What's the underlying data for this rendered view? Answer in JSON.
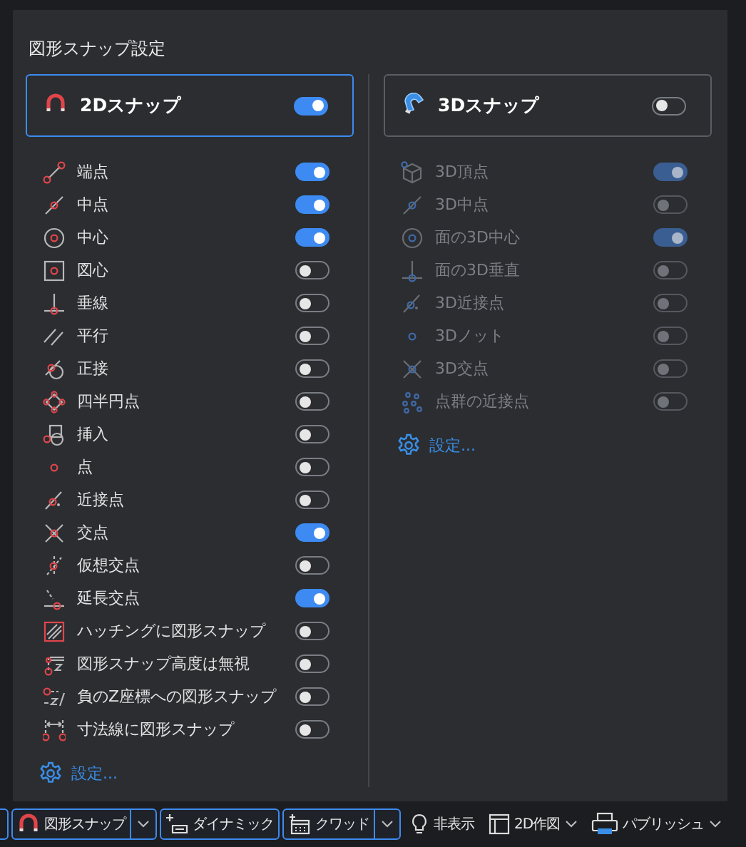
{
  "panel": {
    "title": "図形スナップ設定",
    "sections": [
      {
        "title": "2Dスナップ",
        "selected": true,
        "on": true,
        "disabled": false,
        "settings_link": "設定...",
        "items": [
          {
            "label": "端点",
            "on": true
          },
          {
            "label": "中点",
            "on": true
          },
          {
            "label": "中心",
            "on": true
          },
          {
            "label": "図心",
            "on": false
          },
          {
            "label": "垂線",
            "on": false
          },
          {
            "label": "平行",
            "on": false
          },
          {
            "label": "正接",
            "on": false
          },
          {
            "label": "四半円点",
            "on": false
          },
          {
            "label": "挿入",
            "on": false
          },
          {
            "label": "点",
            "on": false
          },
          {
            "label": "近接点",
            "on": false
          },
          {
            "label": "交点",
            "on": true
          },
          {
            "label": "仮想交点",
            "on": false
          },
          {
            "label": "延長交点",
            "on": true
          },
          {
            "label": "ハッチングに図形スナップ",
            "on": false
          },
          {
            "label": "図形スナップ高度は無視",
            "on": false
          },
          {
            "label": "負のZ座標への図形スナップ",
            "on": false
          },
          {
            "label": "寸法線に図形スナップ",
            "on": false
          }
        ]
      },
      {
        "title": "3Dスナップ",
        "selected": false,
        "on": false,
        "disabled": true,
        "settings_link": "設定...",
        "items": [
          {
            "label": "3D頂点",
            "on": true
          },
          {
            "label": "3D中点",
            "on": false
          },
          {
            "label": "面の3D中心",
            "on": true
          },
          {
            "label": "面の3D垂直",
            "on": false
          },
          {
            "label": "3D近接点",
            "on": false
          },
          {
            "label": "3Dノット",
            "on": false
          },
          {
            "label": "3D交点",
            "on": false
          },
          {
            "label": "点群の近接点",
            "on": false
          }
        ]
      }
    ]
  },
  "status_bar": {
    "items": [
      {
        "label": "図形スナップ",
        "kind": "split",
        "selected": true
      },
      {
        "label": "ダイナミック",
        "kind": "button",
        "selected": true
      },
      {
        "label": "クワッド",
        "kind": "split",
        "selected": true
      },
      {
        "label": "非表示",
        "kind": "plain",
        "selected": false
      },
      {
        "label": "2D作図",
        "kind": "menu",
        "selected": false
      },
      {
        "label": "パブリッシュ",
        "kind": "menu",
        "selected": false
      }
    ]
  }
}
